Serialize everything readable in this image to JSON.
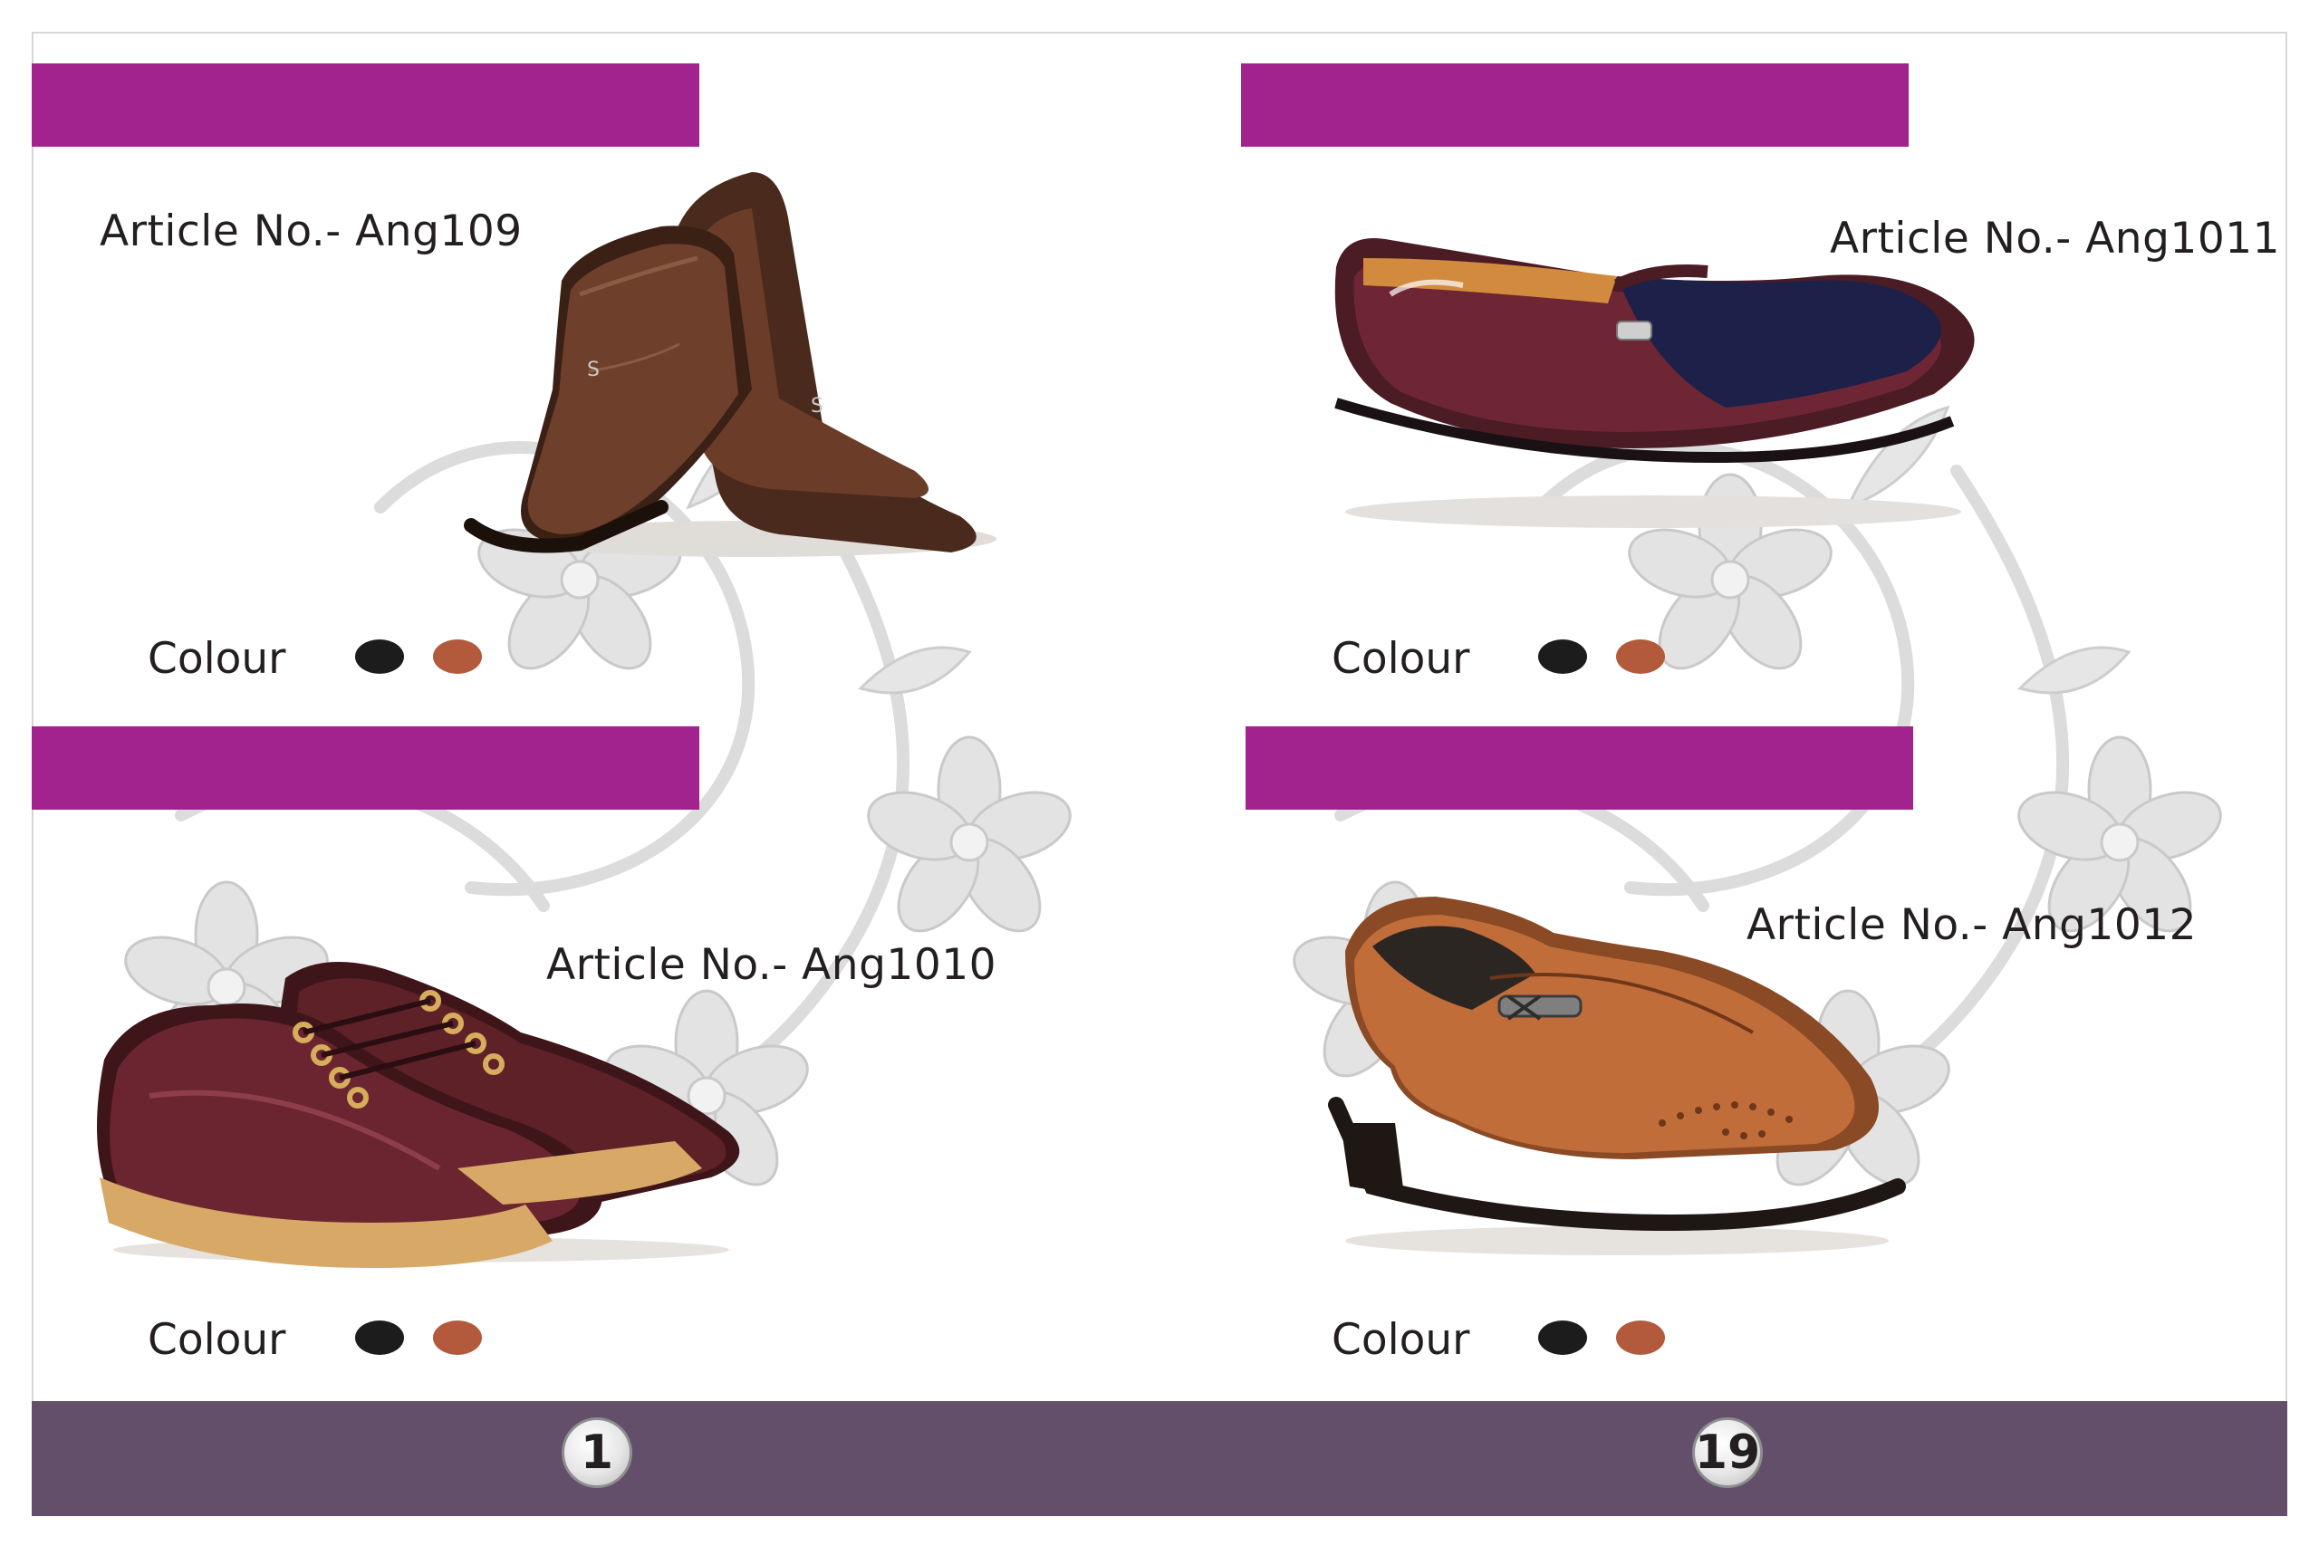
{
  "products": [
    {
      "article": "Article No.- Ang109",
      "colour_label": "Colour",
      "colours": [
        "#1c1c1c",
        "#b35a3c"
      ]
    },
    {
      "article": "Article No.- Ang1011",
      "colour_label": "Colour",
      "colours": [
        "#1c1c1c",
        "#b35a3c"
      ]
    },
    {
      "article": "Article No.- Ang1010",
      "colour_label": "Colour",
      "colours": [
        "#1c1c1c",
        "#b35a3c"
      ]
    },
    {
      "article": "Article No.- Ang1012",
      "colour_label": "Colour",
      "colours": [
        "#1c1c1c",
        "#b35a3c"
      ]
    }
  ],
  "footer": {
    "left_page": "1",
    "right_page": "19"
  },
  "colors": {
    "header_bar": "#a2238e",
    "footer_bar": "#634f6a"
  },
  "images": {
    "p1": "brown-slip-on-formal-shoes",
    "p2": "burgundy-patent-loafer",
    "p3": "maroon-lace-up-casual-shoes",
    "p4": "tan-slip-on-brogue-shoe"
  }
}
